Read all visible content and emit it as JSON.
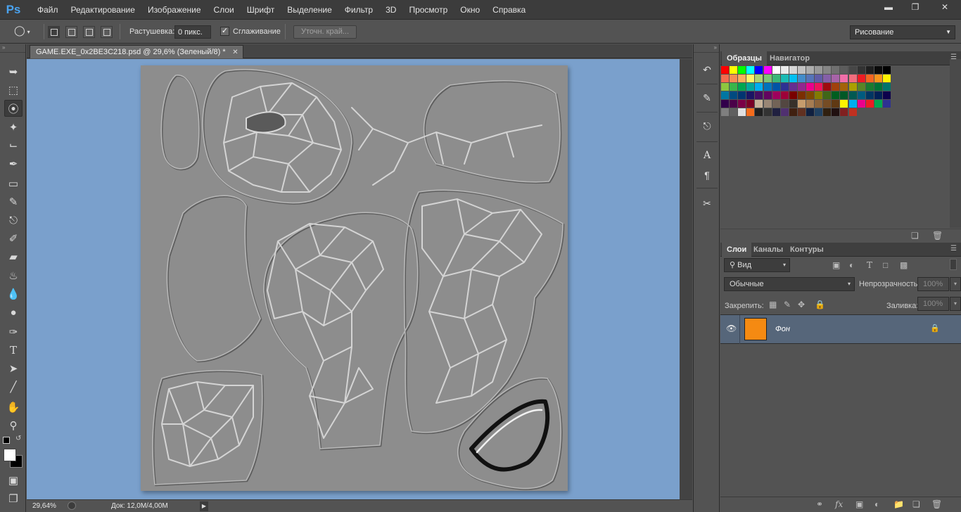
{
  "app": {
    "logo": "Ps",
    "menu": [
      "Файл",
      "Редактирование",
      "Изображение",
      "Слои",
      "Шрифт",
      "Выделение",
      "Фильтр",
      "3D",
      "Просмотр",
      "Окно",
      "Справка"
    ],
    "window_controls": [
      "minimize-icon",
      "restore-icon",
      "close-icon"
    ]
  },
  "options": {
    "feather_label": "Растушевка:",
    "feather_value": "0 пикс.",
    "antialias_label": "Сглаживание",
    "antialias_checked": true,
    "refine_label": "Уточн. край...",
    "workspace": "Рисование"
  },
  "document": {
    "tab_title": "GAME.EXE_0x2BE3C218.psd @ 29,6% (Зеленый/8) *",
    "zoom": "29,64%",
    "doc_size": "Док: 12,0M/4,00M",
    "canvas_bg": "#7aa0cc",
    "image_bg": "#8d8d8d"
  },
  "tools": [
    "move-tool-icon",
    "marquee-tool-icon",
    "lasso-tool-icon",
    "magic-wand-icon",
    "crop-tool-icon",
    "eyedropper-icon",
    "healing-brush-icon",
    "brush-tool-icon",
    "clone-stamp-icon",
    "history-brush-icon",
    "eraser-icon",
    "paint-bucket-icon",
    "blur-tool-icon",
    "dodge-tool-icon",
    "pen-tool-icon",
    "type-tool-icon",
    "path-selection-icon",
    "line-tool-icon",
    "hand-tool-icon",
    "zoom-tool-icon",
    "quick-mask-icon",
    "screen-mode-icon"
  ],
  "type_tool_glyph": "T",
  "swatches_panel": {
    "tabs": [
      "Образцы",
      "Навигатор"
    ],
    "active_tab": "Образцы"
  },
  "layers_panel": {
    "tabs": [
      "Слои",
      "Каналы",
      "Контуры"
    ],
    "active_tab": "Слои",
    "kind_filter": "Вид",
    "blend_mode": "Обычные",
    "opacity_label": "Непрозрачность:",
    "opacity_value": "100%",
    "lock_label": "Закрепить:",
    "fill_label": "Заливка:",
    "fill_value": "100%",
    "layers": [
      {
        "name": "Фон",
        "visible": true,
        "locked": true,
        "thumb_color": "#f58a12"
      }
    ]
  }
}
